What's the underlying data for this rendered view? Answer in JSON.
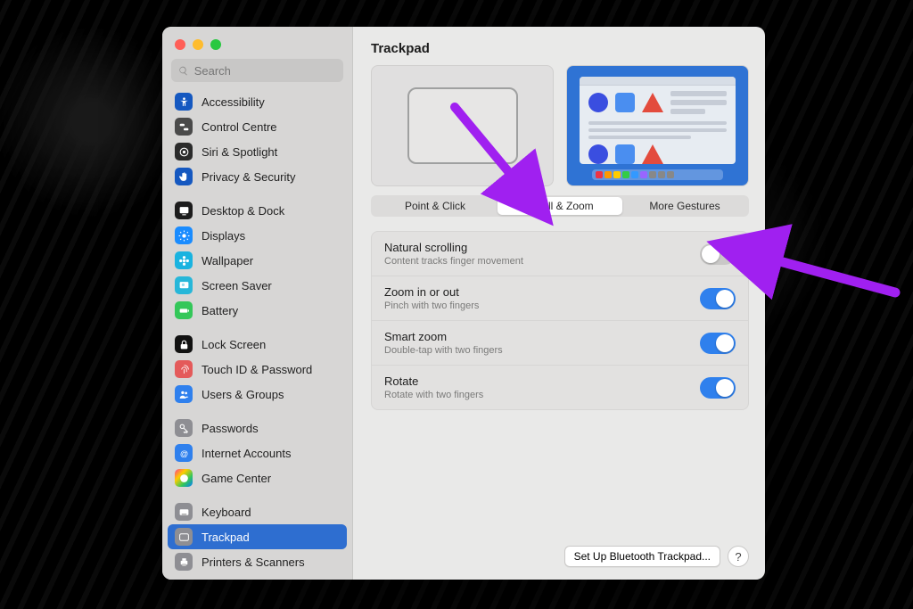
{
  "window": {
    "title": "Trackpad"
  },
  "search": {
    "placeholder": "Search"
  },
  "sidebar": [
    {
      "label": "Accessibility",
      "icon": "accessibility",
      "bg": "#1558c0"
    },
    {
      "label": "Control Centre",
      "icon": "toggles",
      "bg": "#4a4a4a"
    },
    {
      "label": "Siri & Spotlight",
      "icon": "siri",
      "bg": "#2b2b2b"
    },
    {
      "label": "Privacy & Security",
      "icon": "hand",
      "bg": "#1558c0"
    },
    {
      "sep": true
    },
    {
      "label": "Desktop & Dock",
      "icon": "desktop",
      "bg": "#1c1c1c"
    },
    {
      "label": "Displays",
      "icon": "sun",
      "bg": "#1a8cff"
    },
    {
      "label": "Wallpaper",
      "icon": "flower",
      "bg": "#19b3e0"
    },
    {
      "label": "Screen Saver",
      "icon": "screensaver",
      "bg": "#27b7d9"
    },
    {
      "label": "Battery",
      "icon": "battery",
      "bg": "#34c759"
    },
    {
      "sep": true
    },
    {
      "label": "Lock Screen",
      "icon": "lock",
      "bg": "#111"
    },
    {
      "label": "Touch ID & Password",
      "icon": "fingerprint",
      "bg": "#e45a5a"
    },
    {
      "label": "Users & Groups",
      "icon": "users",
      "bg": "#2f80ed"
    },
    {
      "sep": true
    },
    {
      "label": "Passwords",
      "icon": "key",
      "bg": "#8e8e93"
    },
    {
      "label": "Internet Accounts",
      "icon": "at",
      "bg": "#2f80ed"
    },
    {
      "label": "Game Center",
      "icon": "game",
      "bg": "gradient"
    },
    {
      "sep": true
    },
    {
      "label": "Keyboard",
      "icon": "keyboard",
      "bg": "#8e8e93"
    },
    {
      "label": "Trackpad",
      "icon": "trackpad",
      "bg": "#8e8e93",
      "selected": true
    },
    {
      "label": "Printers & Scanners",
      "icon": "printer",
      "bg": "#8e8e93"
    }
  ],
  "tabs": [
    {
      "label": "Point & Click",
      "active": false
    },
    {
      "label": "Scroll & Zoom",
      "active": true
    },
    {
      "label": "More Gestures",
      "active": false
    }
  ],
  "settings": [
    {
      "title": "Natural scrolling",
      "desc": "Content tracks finger movement",
      "on": false
    },
    {
      "title": "Zoom in or out",
      "desc": "Pinch with two fingers",
      "on": true
    },
    {
      "title": "Smart zoom",
      "desc": "Double-tap with two fingers",
      "on": true
    },
    {
      "title": "Rotate",
      "desc": "Rotate with two fingers",
      "on": true
    }
  ],
  "footer": {
    "bluetooth_button": "Set Up Bluetooth Trackpad...",
    "help": "?"
  },
  "annotation": {
    "color": "#a020f0"
  }
}
